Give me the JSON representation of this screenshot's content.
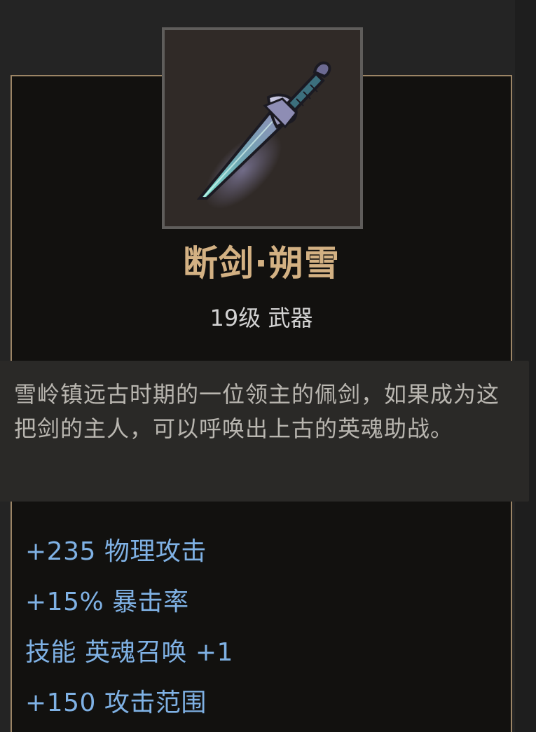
{
  "item": {
    "icon": "broken-sword-icon",
    "name": "断剑·朔雪",
    "level_type": "19级 武器",
    "description": "雪岭镇远古时期的一位领主的佩剑，如果成为这把剑的主人，可以呼唤出上古的英魂助战。",
    "stats": [
      "+235 物理攻击",
      "+15% 暴击率",
      "技能 英魂召唤 +1",
      "+150 攻击范围"
    ]
  },
  "colors": {
    "name": "#d3b183",
    "stat": "#7fb1e4",
    "border": "#9c8566",
    "card_bg": "#12110f",
    "tooltip_bg": "#2a2927"
  }
}
